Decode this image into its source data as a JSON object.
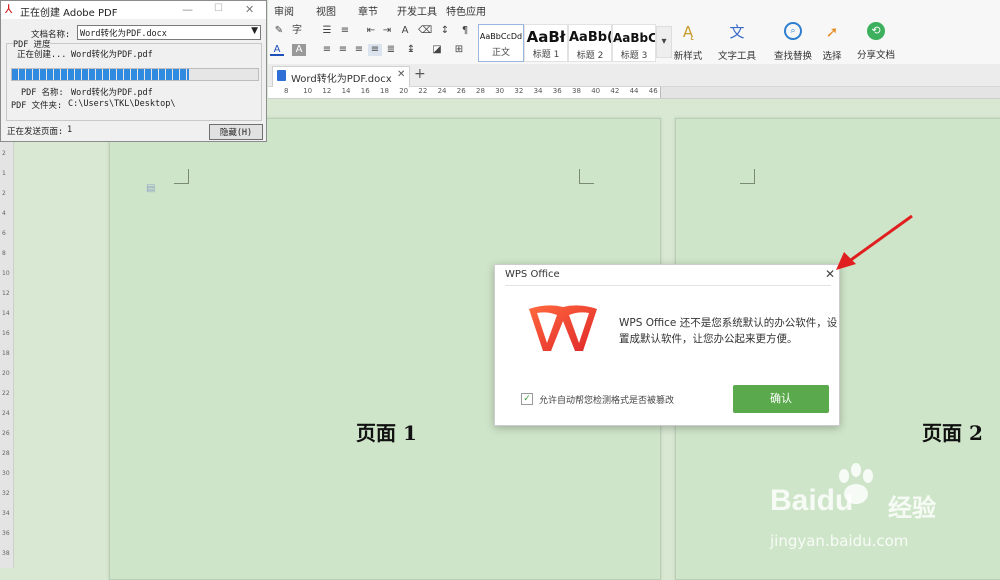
{
  "adobe_dialog": {
    "title": "正在创建 Adobe PDF",
    "doc_name_label": "文档名称:",
    "doc_name_value": "Word转化为PDF.docx",
    "progress_group_label": "PDF 进度",
    "creating_label": "正在创建...",
    "creating_value": "Word转化为PDF.pdf",
    "progress_fraction": 0.72,
    "pdf_name_label": "PDF 名称:",
    "pdf_name_value": "Word转化为PDF.pdf",
    "pdf_folder_label": "PDF 文件夹:",
    "pdf_folder_value": "C:\\Users\\TKL\\Desktop\\",
    "sending_page_label": "正在发送页面:",
    "sending_page_value": "1",
    "hide_button_label": "隐藏(H)"
  },
  "menu_tabs": [
    "审阅",
    "视图",
    "章节",
    "开发工具",
    "特色应用"
  ],
  "styles": [
    {
      "sample": "AaBbCcDd",
      "name": "正文"
    },
    {
      "sample": "AaBł",
      "name": "标题 1"
    },
    {
      "sample": "AaBb(",
      "name": "标题 2"
    },
    {
      "sample": "AaBbC",
      "name": "标题 3"
    }
  ],
  "tools": [
    {
      "label": "新样式",
      "icon": "new-style-icon"
    },
    {
      "label": "文字工具",
      "icon": "text-tool-icon"
    },
    {
      "label": "查找替换",
      "icon": "find-replace-icon"
    },
    {
      "label": "选择",
      "icon": "select-cursor-icon"
    },
    {
      "label": "分享文档",
      "icon": "share-icon"
    }
  ],
  "doc_tab": {
    "title": "Word转化为PDF.docx"
  },
  "ruler_numbers": [
    "8",
    "10",
    "12",
    "14",
    "16",
    "18",
    "20",
    "22",
    "24",
    "26",
    "28",
    "30",
    "32",
    "34",
    "36",
    "38",
    "40",
    "42",
    "44",
    "46"
  ],
  "vruler_numbers": [
    "2",
    "1",
    "2",
    "4",
    "6",
    "8",
    "10",
    "12",
    "14",
    "16",
    "18",
    "20",
    "22",
    "24",
    "26",
    "28",
    "30",
    "32",
    "34",
    "36",
    "38"
  ],
  "pages": [
    {
      "label": "页面 1"
    },
    {
      "label": "页面 2"
    }
  ],
  "wps_modal": {
    "title": "WPS Office",
    "message_line1": "WPS Office 还不是您系统默认的办公软件，设",
    "message_line2": "置成默认软件，让您办公起来更方便。",
    "checkbox_label": "允许自动帮您检测格式是否被篡改",
    "checkbox_checked": true,
    "confirm_label": "确认",
    "logo_color": "#e8452c",
    "confirm_color": "#5aa94c"
  },
  "watermark": {
    "brand": "Baidu",
    "brand_cn": "经验",
    "url": "jingyan.baidu.com"
  }
}
